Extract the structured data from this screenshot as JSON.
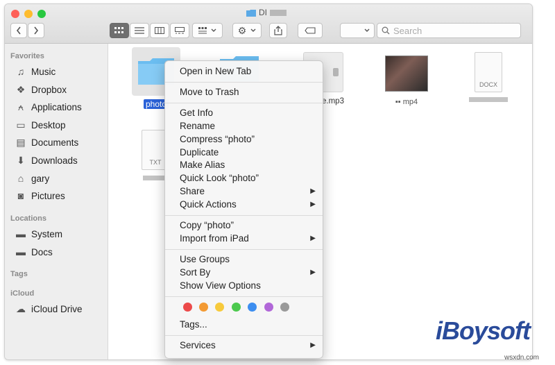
{
  "window": {
    "title": "DI",
    "traffic_lights": [
      "#fe5f57",
      "#febc2e",
      "#28c840"
    ]
  },
  "toolbar": {
    "back_icon": "chevron-left-icon",
    "forward_icon": "chevron-right-icon",
    "view_icons": [
      "icon-view",
      "list-view",
      "column-view",
      "gallery-view"
    ],
    "group_icon": "group-icon",
    "action_icon": "gear-icon",
    "share_icon": "share-icon",
    "tag_icon": "tag-icon",
    "search_placeholder": "Search"
  },
  "sidebar": {
    "favorites_header": "Favorites",
    "favorites": [
      {
        "label": "Music",
        "icon": "music-icon"
      },
      {
        "label": "Dropbox",
        "icon": "dropbox-icon"
      },
      {
        "label": "Applications",
        "icon": "applications-icon"
      },
      {
        "label": "Desktop",
        "icon": "desktop-icon"
      },
      {
        "label": "Documents",
        "icon": "documents-icon"
      },
      {
        "label": "Downloads",
        "icon": "downloads-icon"
      },
      {
        "label": "gary",
        "icon": "home-icon"
      },
      {
        "label": "Pictures",
        "icon": "pictures-icon"
      }
    ],
    "locations_header": "Locations",
    "locations": [
      {
        "label": "System",
        "icon": "disk-icon"
      },
      {
        "label": "Docs",
        "icon": "disk-icon"
      }
    ],
    "tags_header": "Tags",
    "icloud_header": "iCloud",
    "icloud": [
      {
        "label": "iCloud Drive",
        "icon": "cloud-icon"
      }
    ]
  },
  "files": {
    "photo_label": "photo",
    "mp3_label": "e.mp3",
    "mp4_label": "mp4",
    "docx_type": "DOCX",
    "txt_type": "TXT"
  },
  "context_menu": {
    "open_new_tab": "Open in New Tab",
    "move_to_trash": "Move to Trash",
    "get_info": "Get Info",
    "rename": "Rename",
    "compress": "Compress “photo”",
    "duplicate": "Duplicate",
    "make_alias": "Make Alias",
    "quick_look": "Quick Look “photo”",
    "share": "Share",
    "quick_actions": "Quick Actions",
    "copy": "Copy “photo”",
    "import_ipad": "Import from iPad",
    "use_groups": "Use Groups",
    "sort_by": "Sort By",
    "show_view_options": "Show View Options",
    "tag_colors": [
      "#ec4a4a",
      "#f39a33",
      "#f7ca3c",
      "#4cc94e",
      "#3d8ef0",
      "#b167d8",
      "#9a9a9a"
    ],
    "tags": "Tags...",
    "services": "Services",
    "submenu_arrow": "▶"
  },
  "branding": {
    "logo": "iBoysoft",
    "watermark": "wsxdn.com"
  }
}
